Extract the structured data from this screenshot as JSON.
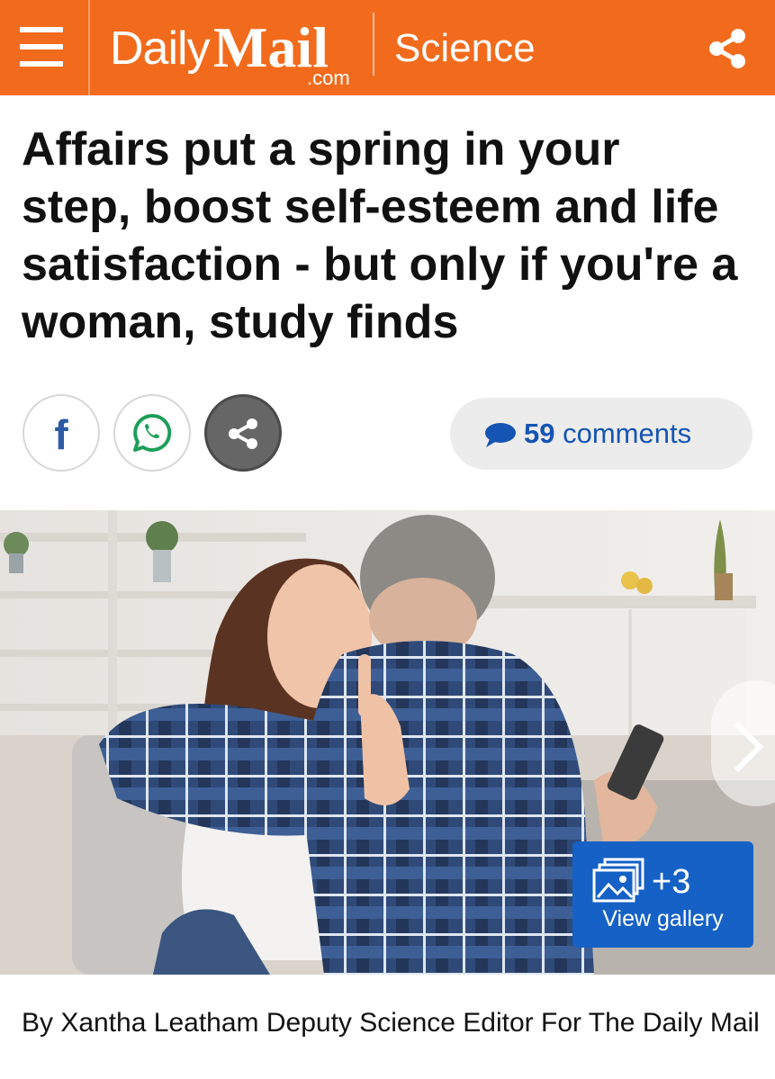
{
  "header": {
    "menu_icon": "hamburger-menu-icon",
    "logo_daily": "Daily",
    "logo_mail": "Mail",
    "logo_com": ".com",
    "section": "Science",
    "share_icon": "share-icon",
    "background_color": "#f26b1d"
  },
  "article": {
    "headline": "Affairs put a spring in your step, boost self-esteem and life satisfaction - but only if you're a woman, study finds",
    "byline": "By Xantha Leatham Deputy Science Editor For The Daily Mail"
  },
  "share_bar": {
    "facebook_icon": "facebook-icon",
    "facebook_glyph": "f",
    "whatsapp_icon": "whatsapp-icon",
    "more_share_icon": "share-icon",
    "comments_icon": "speech-bubble-icon",
    "comments_count": "59",
    "comments_label": "comments",
    "comments_color": "#1554b3"
  },
  "gallery": {
    "count": "+3",
    "label": "View gallery",
    "icon": "gallery-icon",
    "next_icon": "chevron-right-icon",
    "button_color": "#1561c6"
  }
}
